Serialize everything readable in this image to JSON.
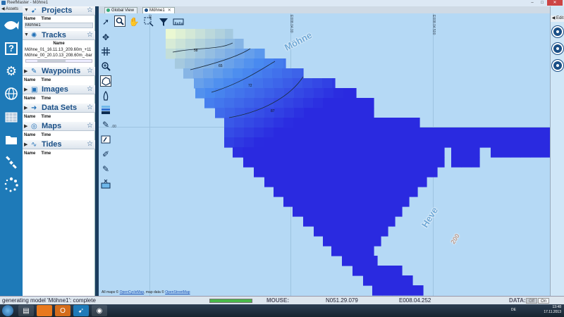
{
  "window": {
    "title": "ReefMaster - Möhne1"
  },
  "rail": {
    "assets_label": "◀ Assets"
  },
  "assets": {
    "projects": {
      "title": "Projects",
      "columns": [
        "Name",
        "Time"
      ],
      "rows": [
        "Möhne1"
      ]
    },
    "tracks": {
      "title": "Tracks",
      "column": "Name",
      "rows": [
        "Möhne_01_16.11.13_209.60m_+11",
        "Möhne_00_20.10.13_208.60m_-bar"
      ]
    },
    "waypoints": {
      "title": "Waypoints",
      "columns": [
        "Name",
        "Time"
      ]
    },
    "images": {
      "title": "Images",
      "columns": [
        "Name",
        "Time"
      ]
    },
    "datasets": {
      "title": "Data Sets",
      "columns": [
        "Name",
        "Time"
      ]
    },
    "maps": {
      "title": "Maps",
      "columns": [
        "Name",
        "Time"
      ]
    },
    "tides": {
      "title": "Tides",
      "columns": [
        "Name",
        "Time"
      ]
    }
  },
  "tabs": [
    {
      "label": "Global View"
    },
    {
      "label": "Möhne1",
      "close": "✕"
    }
  ],
  "map": {
    "place_labels": [
      "Möhne",
      "Heve",
      "200"
    ],
    "grid_labels": [
      "E008.04.00",
      "E008.04.500"
    ],
    "grid_left_label": "00",
    "grid_row_label": ".00",
    "contour_labels": [
      "58",
      "65",
      "72",
      "87"
    ],
    "attribution": "All maps © ",
    "attribution_link1": "OpenCycleMap",
    "attribution_mid": ", map data © ",
    "attribution_link2": "OpenStreetMap"
  },
  "right_panel": {
    "edit_label": "◀ Edit"
  },
  "status": {
    "message": "generating model 'Möhne1': complete",
    "progress": 1.0,
    "mouse_label": "MOUSE:",
    "lat": "N051.29.079",
    "lon": "E008.04.252",
    "data_label": "DATA:",
    "off": "Off",
    "on": "On"
  },
  "taskbar": {
    "lang": "DE",
    "time": "13:48",
    "date": "17.11.2013"
  },
  "colors": {
    "accent": "#1e7ab8",
    "deep": "#2929e0",
    "mid": "#3e6ff0",
    "shallow": "#cfeefd",
    "water": "#b5d9f5"
  }
}
